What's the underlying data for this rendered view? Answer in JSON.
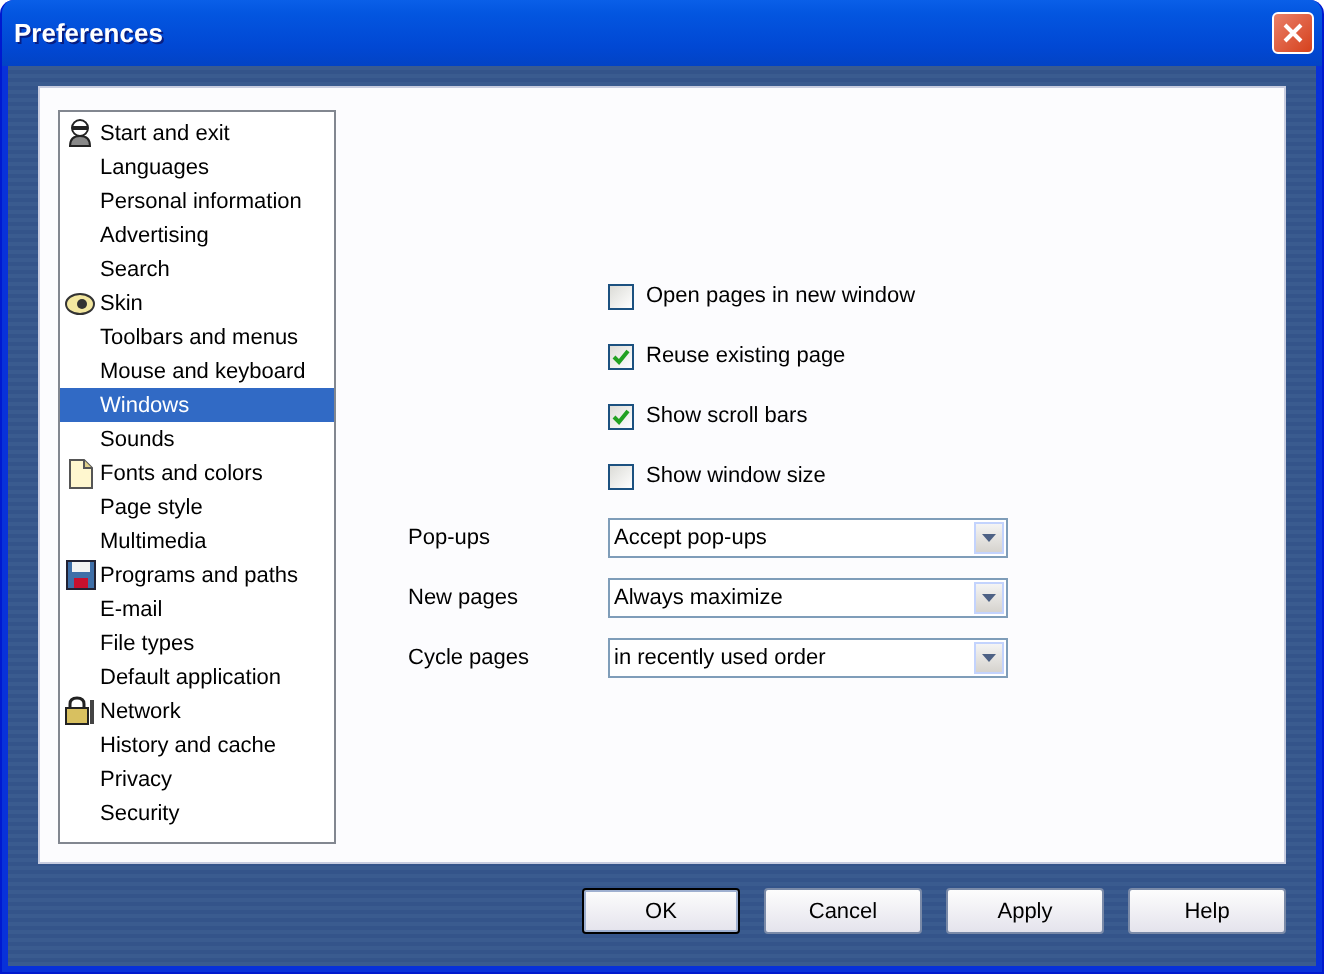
{
  "window": {
    "title": "Preferences"
  },
  "sidebar": {
    "items": [
      {
        "label": "Start and exit",
        "kind": "section",
        "selected": false
      },
      {
        "label": "Languages",
        "kind": "item",
        "selected": false
      },
      {
        "label": "Personal information",
        "kind": "item",
        "selected": false
      },
      {
        "label": "Advertising",
        "kind": "item",
        "selected": false
      },
      {
        "label": "Search",
        "kind": "item",
        "selected": false
      },
      {
        "label": "Skin",
        "kind": "section",
        "selected": false
      },
      {
        "label": "Toolbars and menus",
        "kind": "item",
        "selected": false
      },
      {
        "label": "Mouse and keyboard",
        "kind": "item",
        "selected": false
      },
      {
        "label": "Windows",
        "kind": "item",
        "selected": true
      },
      {
        "label": "Sounds",
        "kind": "item",
        "selected": false
      },
      {
        "label": "Fonts and colors",
        "kind": "section",
        "selected": false
      },
      {
        "label": "Page style",
        "kind": "item",
        "selected": false
      },
      {
        "label": "Multimedia",
        "kind": "item",
        "selected": false
      },
      {
        "label": "Programs and paths",
        "kind": "section",
        "selected": false
      },
      {
        "label": "E-mail",
        "kind": "item",
        "selected": false
      },
      {
        "label": "File types",
        "kind": "item",
        "selected": false
      },
      {
        "label": "Default application",
        "kind": "item",
        "selected": false
      },
      {
        "label": "Network",
        "kind": "section",
        "selected": false
      },
      {
        "label": "History and cache",
        "kind": "item",
        "selected": false
      },
      {
        "label": "Privacy",
        "kind": "item",
        "selected": false
      },
      {
        "label": "Security",
        "kind": "item",
        "selected": false
      }
    ]
  },
  "checkboxes": [
    {
      "label": "Open pages in new window",
      "checked": false
    },
    {
      "label": "Reuse existing page",
      "checked": true
    },
    {
      "label": "Show scroll bars",
      "checked": true
    },
    {
      "label": "Show window size",
      "checked": false
    }
  ],
  "dropdowns": [
    {
      "label": "Pop-ups",
      "value": "Accept pop-ups"
    },
    {
      "label": "New pages",
      "value": "Always maximize"
    },
    {
      "label": "Cycle pages",
      "value": "in recently used order"
    }
  ],
  "buttons": [
    {
      "label": "OK",
      "default": true
    },
    {
      "label": "Cancel",
      "default": false
    },
    {
      "label": "Apply",
      "default": false
    },
    {
      "label": "Help",
      "default": false
    }
  ]
}
